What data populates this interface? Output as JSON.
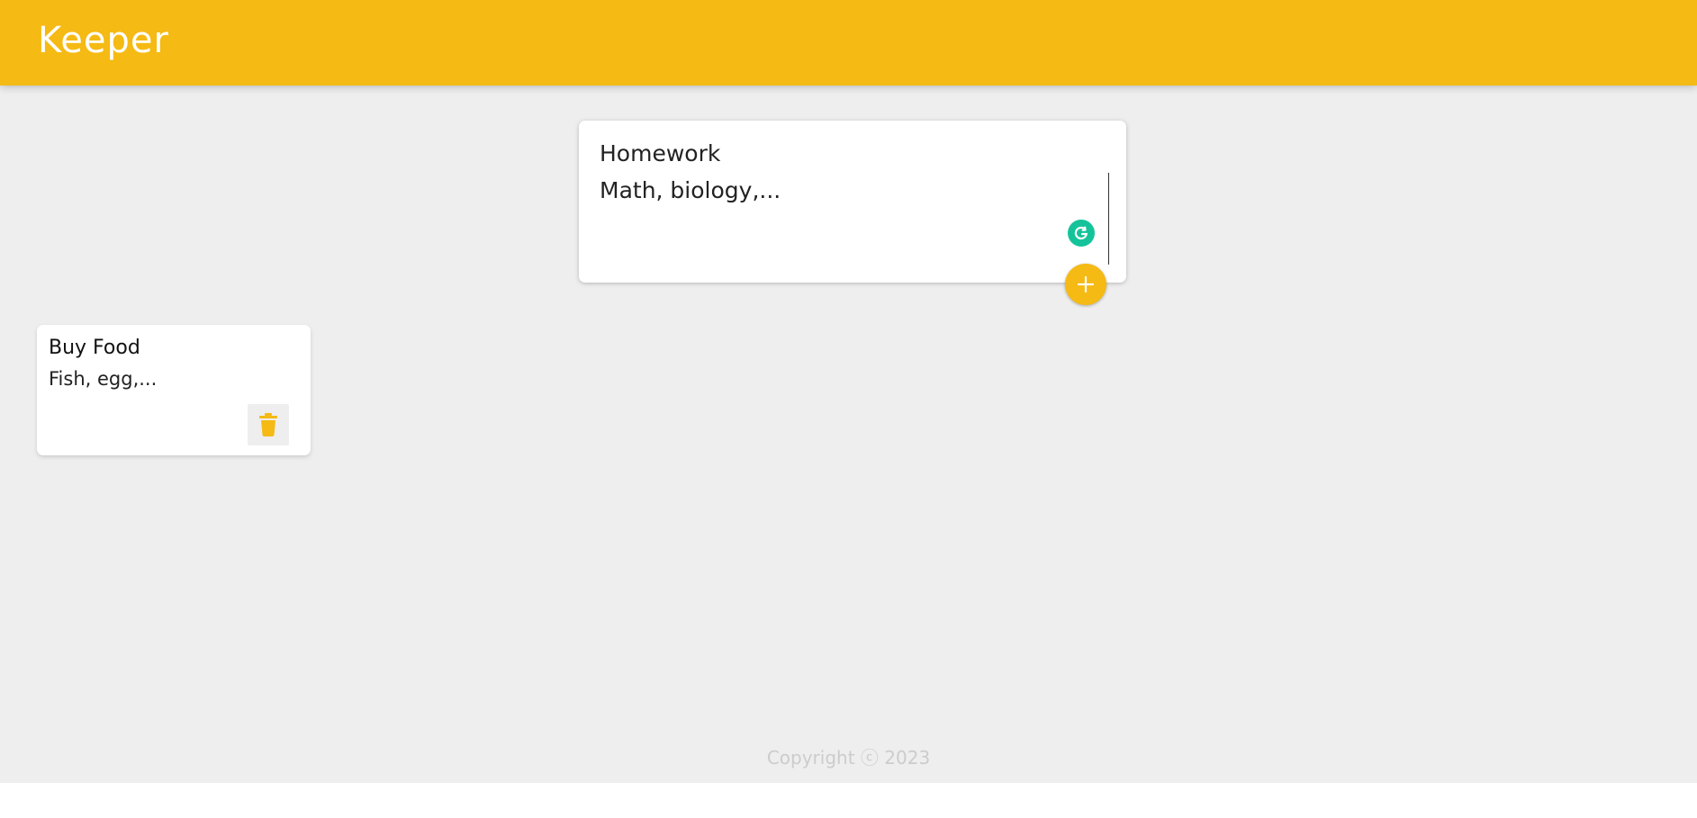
{
  "header": {
    "title": "Keeper",
    "color": "#f5ba13"
  },
  "create_note": {
    "title_value": "Homework",
    "content_value": "Math, biology,...",
    "grammarly_icon": "grammarly-icon",
    "add_icon": "plus-icon"
  },
  "notes": [
    {
      "title": "Buy Food",
      "content": "Fish, egg,...",
      "delete_icon": "trash-icon"
    }
  ],
  "footer": {
    "text": "Copyright ⓒ 2023"
  },
  "colors": {
    "accent": "#f5ba13",
    "background": "#eeeeee",
    "grammarly": "#15c39a"
  }
}
